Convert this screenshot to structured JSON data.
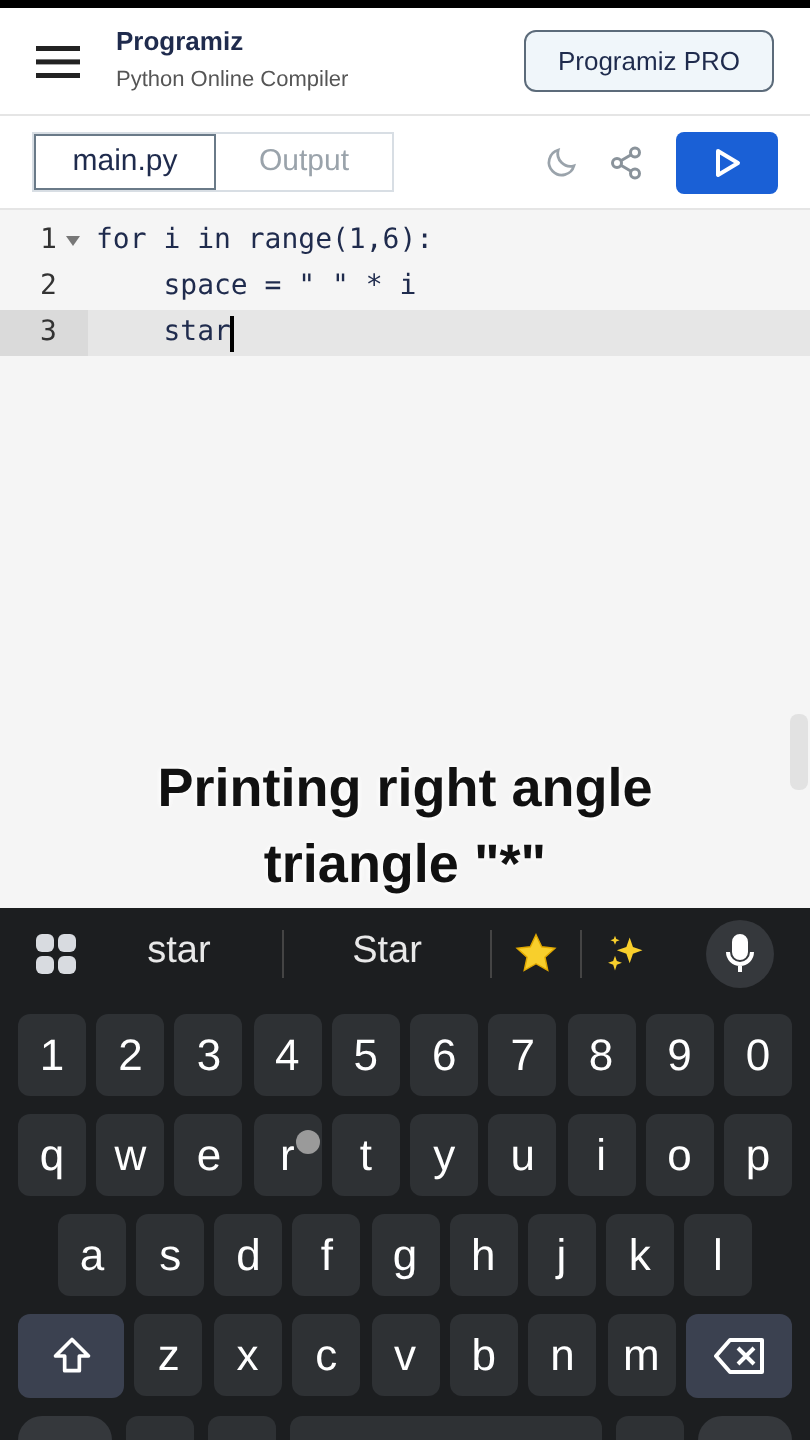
{
  "header": {
    "logo": "Programiz",
    "subtitle": "Python Online Compiler",
    "pro_button": "Programiz PRO"
  },
  "tabs": [
    {
      "label": "main.py",
      "selected": true
    },
    {
      "label": "Output",
      "selected": false
    }
  ],
  "editor": {
    "lines": [
      {
        "number": "1",
        "code": "for i in range(1,6):",
        "foldable": true,
        "active": false
      },
      {
        "number": "2",
        "code": "    space = \" \" * i",
        "foldable": false,
        "active": false
      },
      {
        "number": "3",
        "code": "    star",
        "foldable": false,
        "active": true
      }
    ]
  },
  "caption": [
    "Printing right angle",
    "triangle \"*\""
  ],
  "keyboard": {
    "suggestions": [
      "star",
      "Star"
    ],
    "rows": [
      {
        "kind": "keys",
        "keys": [
          {
            "label": "1",
            "pressed": false
          },
          {
            "label": "2",
            "pressed": false
          },
          {
            "label": "3",
            "pressed": false
          },
          {
            "label": "4",
            "pressed": false
          },
          {
            "label": "5",
            "pressed": false
          },
          {
            "label": "6",
            "pressed": false
          },
          {
            "label": "7",
            "pressed": false
          },
          {
            "label": "8",
            "pressed": false
          },
          {
            "label": "9",
            "pressed": false
          },
          {
            "label": "0",
            "pressed": false
          }
        ]
      },
      {
        "kind": "keys",
        "keys": [
          {
            "label": "q",
            "pressed": false
          },
          {
            "label": "w",
            "pressed": false
          },
          {
            "label": "e",
            "pressed": false
          },
          {
            "label": "r",
            "pressed": true
          },
          {
            "label": "t",
            "pressed": false
          },
          {
            "label": "y",
            "pressed": false
          },
          {
            "label": "u",
            "pressed": false
          },
          {
            "label": "i",
            "pressed": false
          },
          {
            "label": "o",
            "pressed": false
          },
          {
            "label": "p",
            "pressed": false
          }
        ]
      },
      {
        "kind": "inset",
        "keys": [
          {
            "label": "a",
            "pressed": false
          },
          {
            "label": "s",
            "pressed": false
          },
          {
            "label": "d",
            "pressed": false
          },
          {
            "label": "f",
            "pressed": false
          },
          {
            "label": "g",
            "pressed": false
          },
          {
            "label": "h",
            "pressed": false
          },
          {
            "label": "j",
            "pressed": false
          },
          {
            "label": "k",
            "pressed": false
          },
          {
            "label": "l",
            "pressed": false
          }
        ]
      },
      {
        "kind": "shift",
        "keys": [
          {
            "label": "z",
            "pressed": false
          },
          {
            "label": "x",
            "pressed": false
          },
          {
            "label": "c",
            "pressed": false
          },
          {
            "label": "v",
            "pressed": false
          },
          {
            "label": "b",
            "pressed": false
          },
          {
            "label": "n",
            "pressed": false
          },
          {
            "label": "m",
            "pressed": false
          }
        ]
      }
    ]
  }
}
